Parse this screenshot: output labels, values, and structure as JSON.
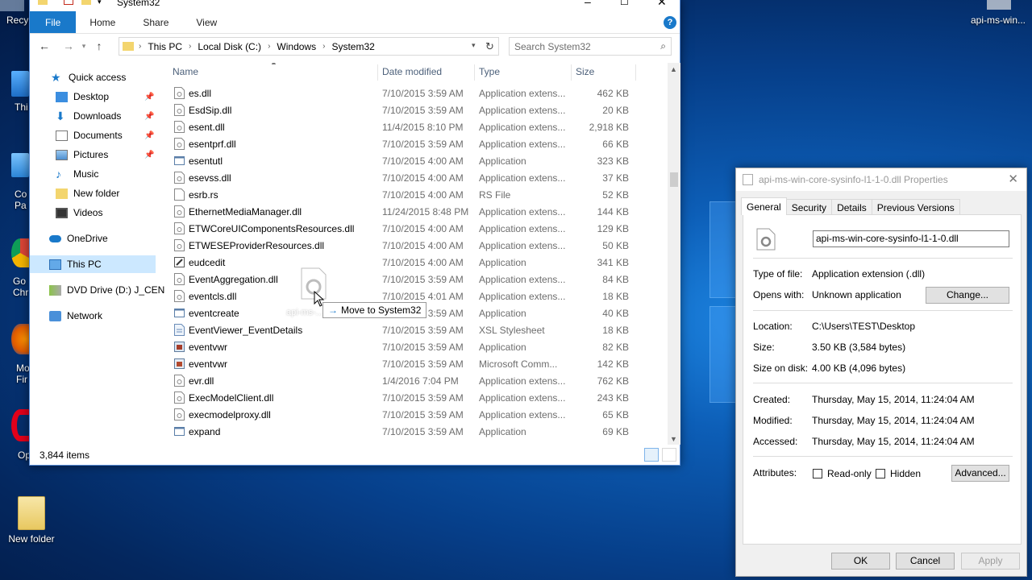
{
  "desktop": {
    "top_right_label": "api-ms-win...",
    "left_clips": [
      "Recy",
      "Thi",
      "Co\nPa",
      "Go\nChr",
      "Mo\nFir",
      "Op"
    ],
    "new_folder_label": "New folder"
  },
  "explorer": {
    "title": "System32",
    "ribbon_tabs": [
      "File",
      "Home",
      "Share",
      "View"
    ],
    "help": "?",
    "address": [
      "This PC",
      "Local Disk (C:)",
      "Windows",
      "System32"
    ],
    "search_placeholder": "Search System32",
    "nav": {
      "quick_access": "Quick access",
      "desktop": "Desktop",
      "downloads": "Downloads",
      "documents": "Documents",
      "pictures": "Pictures",
      "music": "Music",
      "new_folder": "New folder",
      "videos": "Videos",
      "onedrive": "OneDrive",
      "this_pc": "This PC",
      "dvd": "DVD Drive (D:) J_CEN",
      "network": "Network"
    },
    "columns": {
      "name": "Name",
      "date": "Date modified",
      "type": "Type",
      "size": "Size"
    },
    "files": [
      {
        "name": "es.dll",
        "date": "7/10/2015 3:59 AM",
        "type": "Application extens...",
        "size": "462 KB",
        "icon": "dll"
      },
      {
        "name": "EsdSip.dll",
        "date": "7/10/2015 3:59 AM",
        "type": "Application extens...",
        "size": "20 KB",
        "icon": "dll"
      },
      {
        "name": "esent.dll",
        "date": "11/4/2015 8:10 PM",
        "type": "Application extens...",
        "size": "2,918 KB",
        "icon": "dll"
      },
      {
        "name": "esentprf.dll",
        "date": "7/10/2015 3:59 AM",
        "type": "Application extens...",
        "size": "66 KB",
        "icon": "dll"
      },
      {
        "name": "esentutl",
        "date": "7/10/2015 4:00 AM",
        "type": "Application",
        "size": "323 KB",
        "icon": "exe"
      },
      {
        "name": "esevss.dll",
        "date": "7/10/2015 4:00 AM",
        "type": "Application extens...",
        "size": "37 KB",
        "icon": "dll"
      },
      {
        "name": "esrb.rs",
        "date": "7/10/2015 4:00 AM",
        "type": "RS File",
        "size": "52 KB",
        "icon": "file"
      },
      {
        "name": "EthernetMediaManager.dll",
        "date": "11/24/2015 8:48 PM",
        "type": "Application extens...",
        "size": "144 KB",
        "icon": "dll"
      },
      {
        "name": "ETWCoreUIComponentsResources.dll",
        "date": "7/10/2015 4:00 AM",
        "type": "Application extens...",
        "size": "129 KB",
        "icon": "dll"
      },
      {
        "name": "ETWESEProviderResources.dll",
        "date": "7/10/2015 4:00 AM",
        "type": "Application extens...",
        "size": "50 KB",
        "icon": "dll"
      },
      {
        "name": "eudcedit",
        "date": "7/10/2015 4:00 AM",
        "type": "Application",
        "size": "341 KB",
        "icon": "edit"
      },
      {
        "name": "EventAggregation.dll",
        "date": "7/10/2015 3:59 AM",
        "type": "Application extens...",
        "size": "84 KB",
        "icon": "dll"
      },
      {
        "name": "eventcls.dll",
        "date": "7/10/2015 4:01 AM",
        "type": "Application extens...",
        "size": "18 KB",
        "icon": "dll"
      },
      {
        "name": "eventcreate",
        "date": "7/10/2015 3:59 AM",
        "type": "Application",
        "size": "40 KB",
        "icon": "exe"
      },
      {
        "name": "EventViewer_EventDetails",
        "date": "7/10/2015 3:59 AM",
        "type": "XSL Stylesheet",
        "size": "18 KB",
        "icon": "xsl"
      },
      {
        "name": "eventvwr",
        "date": "7/10/2015 3:59 AM",
        "type": "Application",
        "size": "82 KB",
        "icon": "viewer"
      },
      {
        "name": "eventvwr",
        "date": "7/10/2015 3:59 AM",
        "type": "Microsoft Comm...",
        "size": "142 KB",
        "icon": "msc"
      },
      {
        "name": "evr.dll",
        "date": "1/4/2016 7:04 PM",
        "type": "Application extens...",
        "size": "762 KB",
        "icon": "dll"
      },
      {
        "name": "ExecModelClient.dll",
        "date": "7/10/2015 3:59 AM",
        "type": "Application extens...",
        "size": "243 KB",
        "icon": "dll"
      },
      {
        "name": "execmodelproxy.dll",
        "date": "7/10/2015 3:59 AM",
        "type": "Application extens...",
        "size": "65 KB",
        "icon": "dll"
      },
      {
        "name": "expand",
        "date": "7/10/2015 3:59 AM",
        "type": "Application",
        "size": "69 KB",
        "icon": "exe"
      }
    ],
    "status_count": "3,844 items",
    "drag": {
      "ghost_label": "api-ms-...",
      "tooltip": "Move to System32"
    }
  },
  "props": {
    "title": "api-ms-win-core-sysinfo-l1-1-0.dll Properties",
    "tabs": [
      "General",
      "Security",
      "Details",
      "Previous Versions"
    ],
    "filename": "api-ms-win-core-sysinfo-l1-1-0.dll",
    "type_label": "Type of file:",
    "type_value": "Application extension (.dll)",
    "opens_label": "Opens with:",
    "opens_value": "Unknown application",
    "change_btn": "Change...",
    "location_label": "Location:",
    "location_value": "C:\\Users\\TEST\\Desktop",
    "size_label": "Size:",
    "size_value": "3.50 KB (3,584 bytes)",
    "disk_label": "Size on disk:",
    "disk_value": "4.00 KB (4,096 bytes)",
    "created_label": "Created:",
    "created_value": "Thursday, May 15, 2014, 11:24:04 AM",
    "modified_label": "Modified:",
    "modified_value": "Thursday, May 15, 2014, 11:24:04 AM",
    "accessed_label": "Accessed:",
    "accessed_value": "Thursday, May 15, 2014, 11:24:04 AM",
    "attributes_label": "Attributes:",
    "readonly_label": "Read-only",
    "hidden_label": "Hidden",
    "advanced_btn": "Advanced...",
    "ok_btn": "OK",
    "cancel_btn": "Cancel",
    "apply_btn": "Apply"
  },
  "colors": {
    "accent": "#1979ca",
    "selection": "#cce8ff"
  }
}
